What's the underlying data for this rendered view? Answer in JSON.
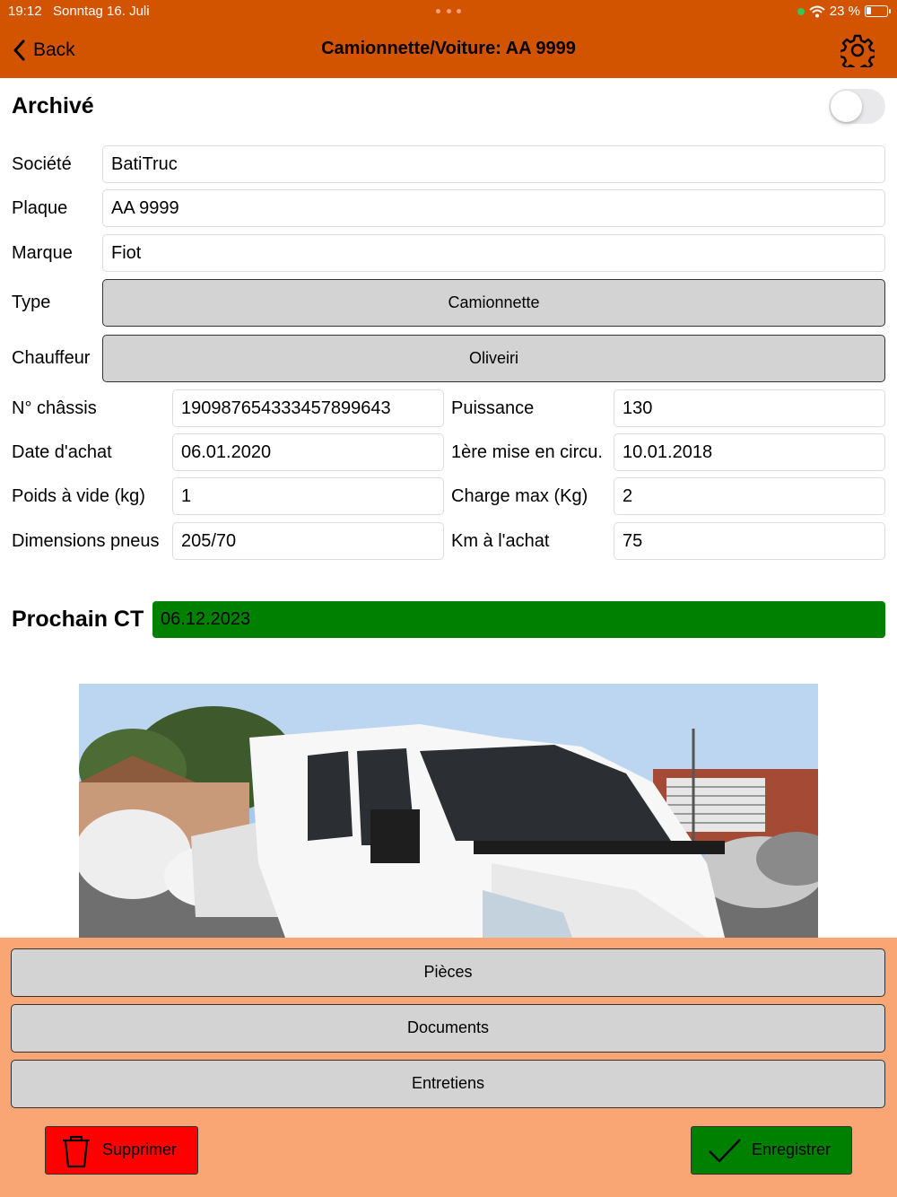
{
  "status_bar": {
    "time": "19:12",
    "date": "Sonntag 16. Juli",
    "battery_text": "23 %",
    "battery_level": 0.23
  },
  "nav": {
    "back_label": "Back",
    "title": "Camionnette/Voiture: AA 9999",
    "settings_icon": "gear-icon"
  },
  "archive": {
    "label": "Archivé",
    "enabled": false
  },
  "form": {
    "societe": {
      "label": "Société",
      "value": "BatiTruc"
    },
    "plaque": {
      "label": "Plaque",
      "value": "AA 9999"
    },
    "marque": {
      "label": "Marque",
      "value": "Fiot"
    },
    "type": {
      "label": "Type",
      "value": "Camionnette"
    },
    "chauffeur": {
      "label": "Chauffeur",
      "value": "Oliveiri"
    },
    "chassis": {
      "label": "N° châssis",
      "value": "190987654333457899643"
    },
    "puissance": {
      "label": "Puissance",
      "value": "130"
    },
    "date_achat": {
      "label": "Date d'achat",
      "value": "06.01.2020"
    },
    "mise_en_circu": {
      "label": "1ère mise en circu.",
      "value": "10.01.2018"
    },
    "poids_vide": {
      "label": "Poids à vide (kg)",
      "value": "1"
    },
    "charge_max": {
      "label": "Charge max (Kg)",
      "value": "2"
    },
    "dimensions_pneus": {
      "label": "Dimensions pneus",
      "value": "205/70"
    },
    "km_achat": {
      "label": "Km à l'achat",
      "value": "75"
    }
  },
  "prochain_ct": {
    "label": "Prochain CT",
    "value": "06.12.2023",
    "status_color": "#008000"
  },
  "sections": {
    "pieces": "Pièces",
    "documents": "Documents",
    "entretiens": "Entretiens"
  },
  "actions": {
    "delete_label": "Supprimer",
    "save_label": "Enregistrer"
  },
  "colors": {
    "header": "#d35400",
    "bottom_panel": "#f9a574",
    "delete": "#ff0000",
    "save": "#008000",
    "picker": "#d3d3d3"
  }
}
